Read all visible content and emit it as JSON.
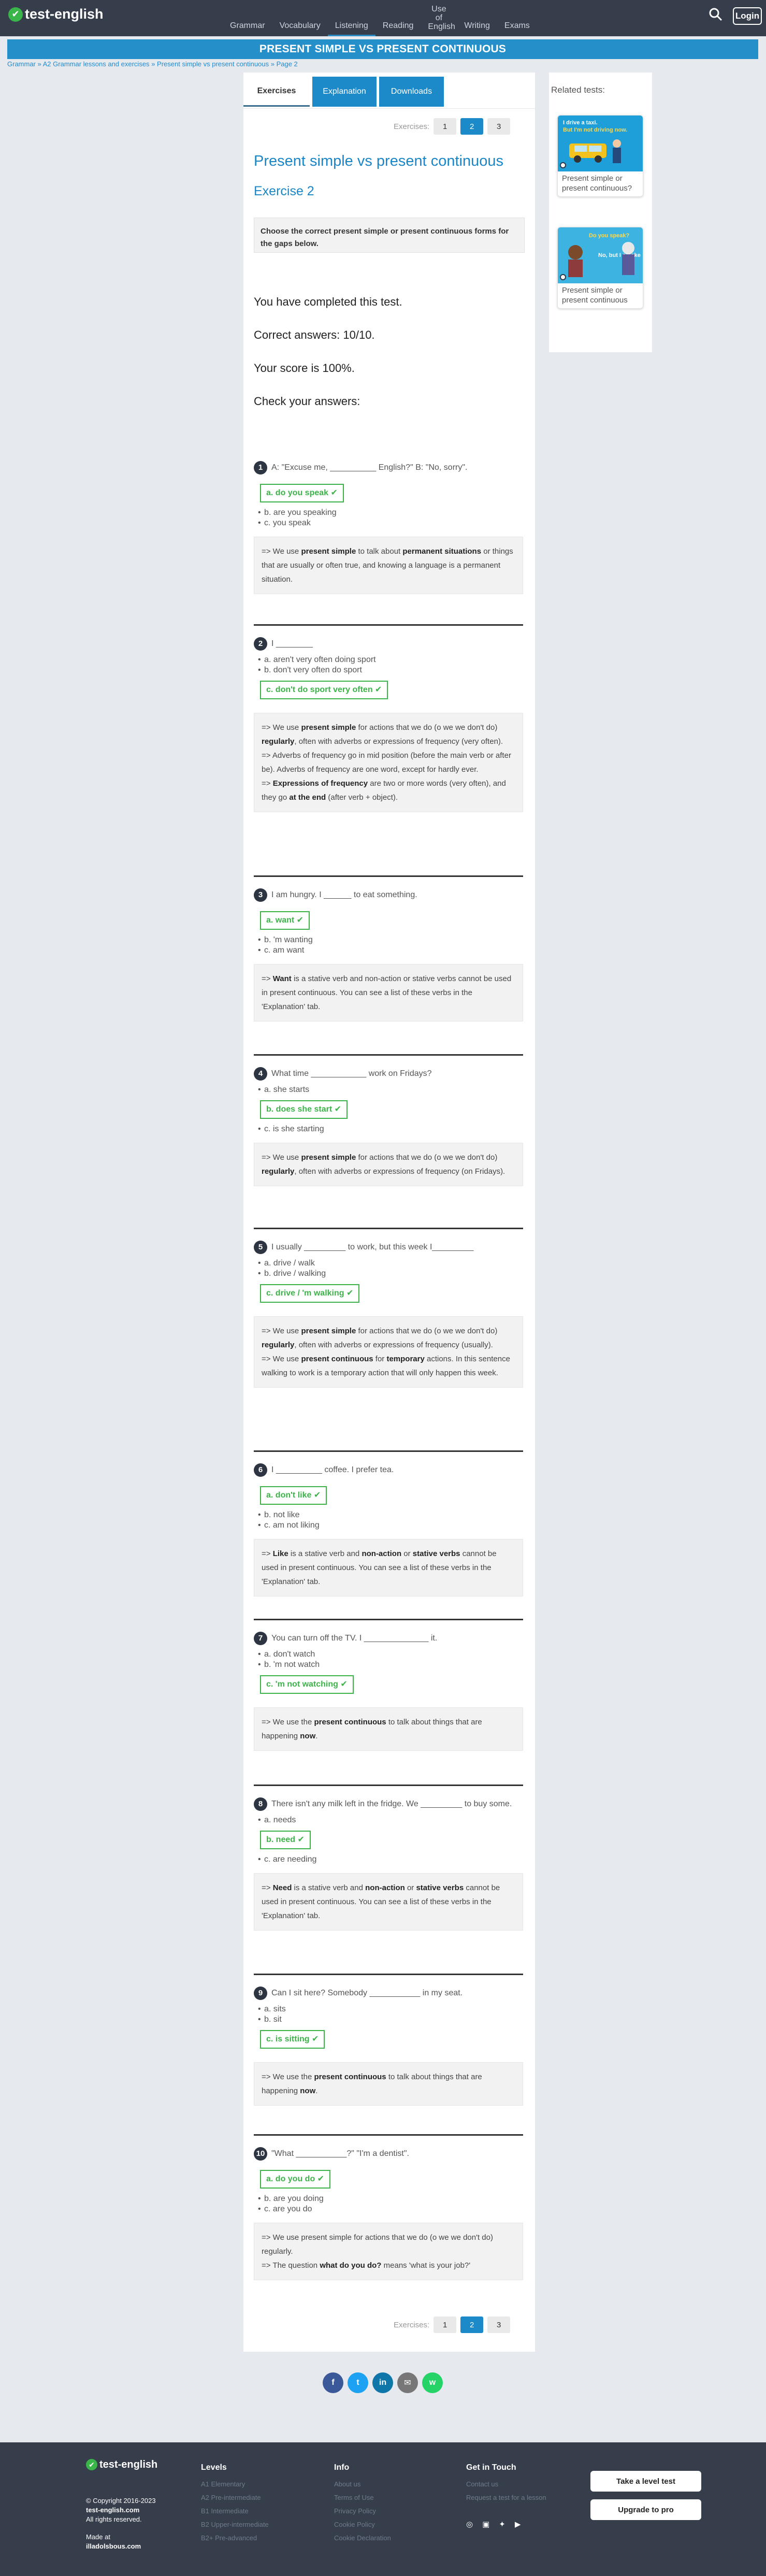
{
  "nav": {
    "logo_text": "test-english",
    "links": [
      "Grammar",
      "Vocabulary",
      "Listening",
      "Reading",
      "Use of English",
      "Writing",
      "Exams"
    ],
    "login_label": "Login"
  },
  "banner": {
    "title": "PRESENT SIMPLE VS PRESENT CONTINUOUS"
  },
  "breadcrumb": [
    "Grammar",
    "A2 Grammar lessons and exercises",
    "Present simple vs present continuous",
    "Page 2"
  ],
  "tabs": [
    "Exercises",
    "Explanation",
    "Downloads"
  ],
  "pager": {
    "label": "Exercises:",
    "pages": [
      "1",
      "2",
      "3"
    ],
    "current": "2"
  },
  "content": {
    "title": "Present simple vs present continuous",
    "exercise": "Exercise 2",
    "instruction": "Choose the correct present simple or present continuous forms for the gaps below.",
    "result_done": "You have completed this test.",
    "result_correct": "Correct answers: 10/10.",
    "result_score": "Your score is 100%.",
    "result_check": "Check your answers:"
  },
  "questions": [
    {
      "n": "1",
      "text": "A: \"Excuse me, __________ English?\" B: \"No, sorry\".",
      "options": [
        "a. do you speak ✔",
        "b. are you speaking",
        "c. you speak"
      ],
      "correct": 0
    },
    {
      "n": "2",
      "text": "I ________",
      "options": [
        "a. aren't very often doing sport",
        "b. don't very often do sport",
        "c. don't do sport very often ✔"
      ],
      "correct": 2
    },
    {
      "n": "3",
      "text": "I am hungry. I ______ to eat something.",
      "options": [
        "a. want ✔",
        "b. 'm wanting",
        "c. am want"
      ],
      "correct": 0
    },
    {
      "n": "4",
      "text": "What time ____________ work on Fridays?",
      "options": [
        "a. she starts",
        "b. does she start ✔",
        "c. is she starting"
      ],
      "correct": 1
    },
    {
      "n": "5",
      "text": "I usually _________ to work, but this week I_________",
      "options": [
        "a. drive / walk",
        "b. drive / walking",
        "c. drive / 'm walking ✔"
      ],
      "correct": 2
    },
    {
      "n": "6",
      "text": "I __________ coffee. I prefer tea.",
      "options": [
        "a. don't like ✔",
        "b. not like",
        "c. am not liking"
      ],
      "correct": 0
    },
    {
      "n": "7",
      "text": "You can turn off the TV. I ______________ it.",
      "options": [
        "a. don't watch",
        "b. 'm not watch",
        "c. 'm not watching ✔"
      ],
      "correct": 2
    },
    {
      "n": "8",
      "text": "There isn't any milk left in the fridge. We _________ to buy some.",
      "options": [
        "a. needs",
        "b. need ✔",
        "c. are needing"
      ],
      "correct": 1
    },
    {
      "n": "9",
      "text": "Can I sit here? Somebody ___________ in my seat.",
      "options": [
        "a. sits",
        "b. sit",
        "c. is sitting ✔"
      ],
      "correct": 2
    },
    {
      "n": "10",
      "text": "\"What ___________?\" \"I'm a dentist\".",
      "options": [
        "a. do you do ✔",
        "b. are you doing",
        "c. are you do"
      ],
      "correct": 0
    }
  ],
  "explanations": [
    [
      "=> We use ",
      {
        "b": "present simple"
      },
      " to talk about ",
      {
        "b": "permanent situations"
      },
      " or things that are usually or often true, and knowing a language is a permanent situation."
    ],
    [
      "=> We use ",
      {
        "b": "present simple"
      },
      " for actions that we do (o we we don't do) ",
      {
        "b": "regularly"
      },
      ", often with adverbs or expressions of frequency (very often).",
      {
        "br": 1
      },
      "=> Adverbs of frequency go in mid position (before the main verb or after be). Adverbs of frequency are one word, except for hardly ever.",
      {
        "br": 1
      },
      "=> ",
      {
        "b": "Expressions of frequency"
      },
      " are two or more words (very often), and they go ",
      {
        "b": "at the end"
      },
      " (after verb + object)."
    ],
    [
      "=> ",
      {
        "b": "Want"
      },
      " is a stative verb and non-action or stative verbs cannot be used in present continuous. You can see a list of these verbs in the 'Explanation' tab."
    ],
    [
      "=> We use ",
      {
        "b": "present simple"
      },
      " for actions that we do (o we we don't do) ",
      {
        "b": "regularly"
      },
      ", often with adverbs or expressions of frequency (on Fridays)."
    ],
    [
      "=> We use ",
      {
        "b": "present simple"
      },
      " for actions that we do (o we we don't do) ",
      {
        "b": "regularly"
      },
      ", often with adverbs or expressions of frequency (usually).",
      {
        "br": 1
      },
      "=> We use ",
      {
        "b": "present continuous"
      },
      " for ",
      {
        "b": "temporary"
      },
      " actions. In this sentence walking to work is a temporary action that will only happen this week."
    ],
    [
      "=> ",
      {
        "b": "Like"
      },
      " is a stative verb and ",
      {
        "b": "non-action"
      },
      " or ",
      {
        "b": "stative verbs"
      },
      " cannot be used in present continuous. You can see a list of these verbs in the 'Explanation' tab."
    ],
    [
      "=> We use the ",
      {
        "b": "present continuous"
      },
      " to talk about things that are happening ",
      {
        "b": "now"
      },
      "."
    ],
    [
      "=> ",
      {
        "b": "Need"
      },
      " is a stative verb and ",
      {
        "b": "non-action"
      },
      " or ",
      {
        "b": "stative verbs"
      },
      " cannot be used in present continuous. You can see a list of these verbs in the 'Explanation' tab."
    ],
    [
      "=> We use the ",
      {
        "b": "present continuous"
      },
      " to talk about things that are happening ",
      {
        "b": "now"
      },
      "."
    ],
    [
      "=> We use present simple for actions that we do (o we we don't do) regularly.",
      {
        "br": 1
      },
      "=> The question ",
      {
        "b": "what do you do?"
      },
      " means 'what is your job?'"
    ]
  ],
  "sidebar": {
    "title": "Related tests:",
    "cards": [
      {
        "caption": "Present simple or present continuous?",
        "img_line1": "I drive a taxi.",
        "img_line2": "But I'm not driving now."
      },
      {
        "caption": "Present simple or present continuous",
        "img_line1": "Do you speak?",
        "img_line2": "No, but I smoke"
      }
    ]
  },
  "share": [
    "f",
    "t",
    "in",
    "✉",
    "w"
  ],
  "footer": {
    "logo_text": "test-english",
    "copyright": "© Copyright 2016-2023",
    "site": "test-english.com",
    "rights": "All rights reserved.",
    "made_at": "Made at",
    "made_by": "illadolsbous.com",
    "levels_title": "Levels",
    "levels": [
      "A1 Elementary",
      "A2 Pre-intermediate",
      "B1 Intermediate",
      "B2 Upper-intermediate",
      "B2+ Pre-advanced"
    ],
    "info_title": "Info",
    "info": [
      "About us",
      "Terms of Use",
      "Privacy Policy",
      "Cookie Policy",
      "Cookie Declaration"
    ],
    "contact_title": "Get in Touch",
    "contact": [
      "Contact us",
      "Request a test for a lesson"
    ],
    "btn_level": "Take a level test",
    "btn_pro": "Upgrade to pro"
  },
  "colors": {
    "primary": "#1c8ac9",
    "correct": "#3db34a",
    "dark": "#363d4b"
  }
}
